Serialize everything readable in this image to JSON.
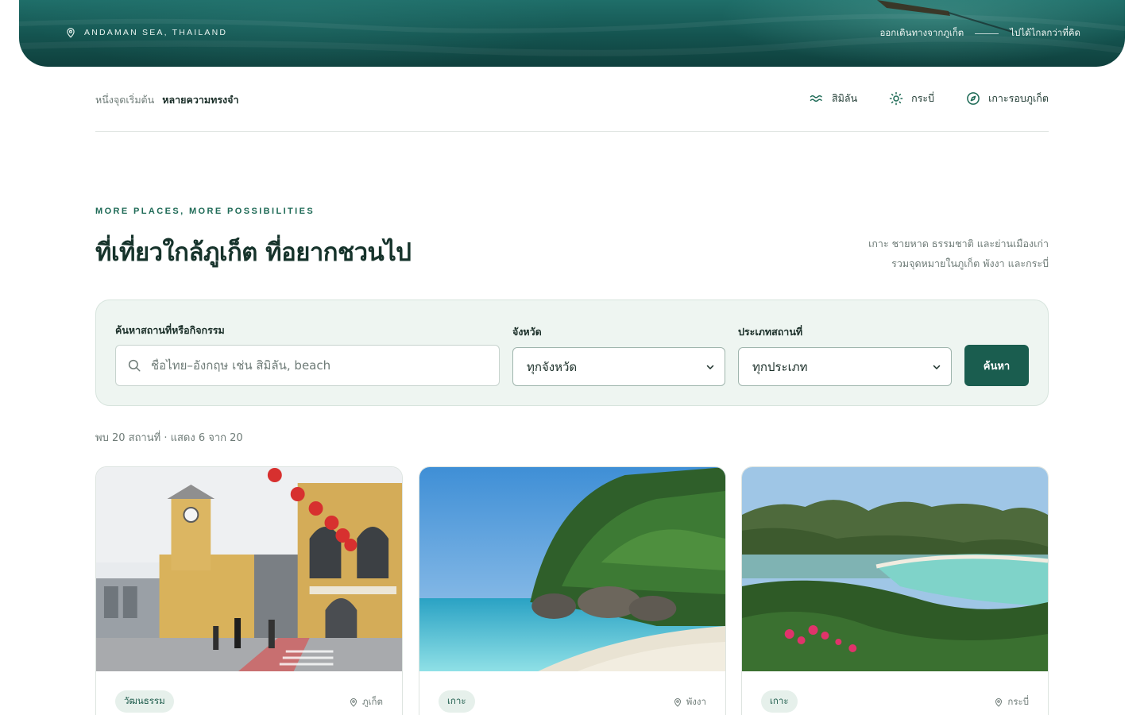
{
  "hero": {
    "location_label": "ANDAMAN SEA, THAILAND",
    "tagline_left": "ออกเดินทางจากภูเก็ต",
    "tagline_right": "ไปได้ไกลกว่าที่คิด"
  },
  "subnav": {
    "intro_muted": "หนึ่งจุดเริ่มต้น",
    "intro_strong": "หลายความทรงจำ",
    "links": [
      {
        "label": "สิมิลัน",
        "icon": "waves-icon"
      },
      {
        "label": "กระบี่",
        "icon": "sun-icon"
      },
      {
        "label": "เกาะรอบภูเก็ต",
        "icon": "compass-icon"
      }
    ]
  },
  "section": {
    "eyebrow": "MORE PLACES, MORE POSSIBILITIES",
    "title": "ที่เที่ยวใกล้ภูเก็ต ที่อยากชวนไป",
    "note_line1": "เกาะ ชายหาด ธรรมชาติ และย่านเมืองเก่า",
    "note_line2": "รวมจุดหมายในภูเก็ต พังงา และกระบี่"
  },
  "search": {
    "query_label": "ค้นหาสถานที่หรือกิจกรรม",
    "query_placeholder": "ชื่อไทย–อังกฤษ เช่น สิมิลัน, beach",
    "province_label": "จังหวัด",
    "province_value": "ทุกจังหวัด",
    "type_label": "ประเภทสถานที่",
    "type_value": "ทุกประเภท",
    "button_label": "ค้นหา"
  },
  "results": {
    "count_text": "พบ 20 สถานที่ · แสดง 6 จาก 20"
  },
  "cards": [
    {
      "tag": "วัฒนธรรม",
      "location": "ภูเก็ต"
    },
    {
      "tag": "เกาะ",
      "location": "พังงา"
    },
    {
      "tag": "เกาะ",
      "location": "กระบี่"
    }
  ],
  "colors": {
    "brand": "#1a5d4f",
    "accent": "#1e6a56",
    "panel": "#eef5f1"
  }
}
